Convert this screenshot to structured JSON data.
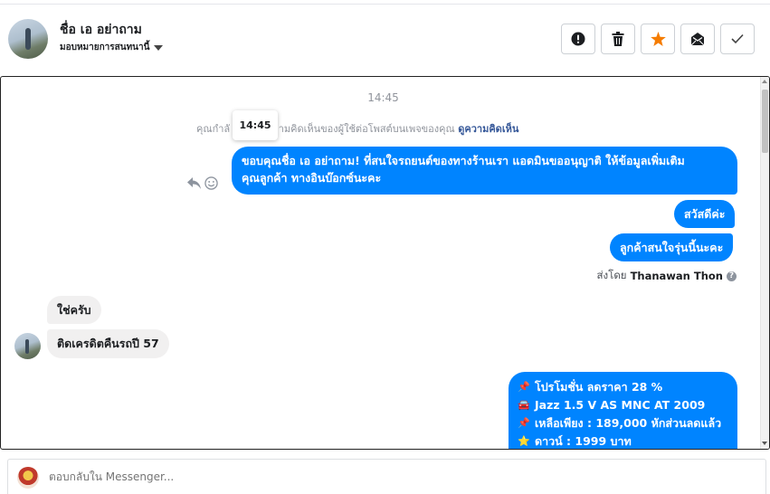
{
  "header": {
    "contact_name": "ชื่อ เอ อย่าถาม",
    "assign_label": "มอบหมายการสนทนานี้",
    "actions": [
      {
        "name": "report-spam",
        "icon": "exclamation-circle-icon"
      },
      {
        "name": "delete",
        "icon": "trash-icon"
      },
      {
        "name": "star",
        "icon": "star-icon",
        "color": "#f57c00"
      },
      {
        "name": "mark-unread",
        "icon": "envelope-icon"
      },
      {
        "name": "mark-done",
        "icon": "checkmark-icon"
      }
    ]
  },
  "conversation": {
    "timestamp": "14:45",
    "tooltip_time": "14:45",
    "notice_prefix": "คุณกำลั",
    "notice_suffix": "ความคิดเห็นของผู้ใช้ต่อโพสต์บนเพจของคุณ",
    "notice_link": "ดูความคิดเห็น",
    "messages": [
      {
        "direction": "out",
        "lines": [
          "ขอบคุณชื่อ เอ อย่าถาม! ที่สนใจรถยนต์ของทางร้านเรา แอดมินขออนุญาติ ให้ข้อมูลเพิ่มเติม",
          "คุณลูกค้า ทางอินบ๊อกซ์นะคะ"
        ]
      },
      {
        "direction": "out",
        "text": "สวัสดีค่ะ"
      },
      {
        "direction": "out",
        "text": "ลูกค้าสนใจรุ่นนี้นะคะ"
      },
      {
        "direction": "in",
        "text": "ใช่ครับ"
      },
      {
        "direction": "in",
        "text": "ติดเครดิตคืนรถปี 57"
      }
    ],
    "sent_by_label": "ส่งโดย",
    "sent_by_name": "Thanawan Thon",
    "help_mark": "?",
    "promo": [
      {
        "emoji": "📌",
        "text": "โปรโมชั่น ลดราคา 28 %"
      },
      {
        "emoji": "🚘",
        "text": "Jazz 1.5 V AS MNC AT 2009"
      },
      {
        "emoji": "📌",
        "text": "เหลือเพียง : 189,000 หักส่วนลดแล้ว"
      },
      {
        "emoji": "⭐",
        "text": "ดาวน์ : 1999 บาท"
      }
    ]
  },
  "composer": {
    "placeholder": "ตอบกลับใน Messenger..."
  }
}
